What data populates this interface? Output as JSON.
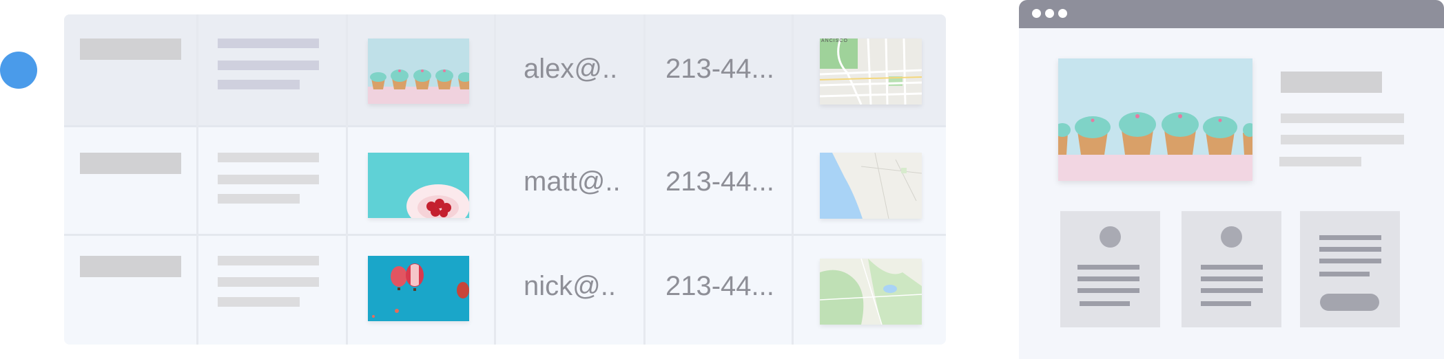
{
  "table": {
    "rows": [
      {
        "email": "alex@..",
        "phone": "213-44...",
        "image": "cupcakes-photo",
        "map": "city-street-map"
      },
      {
        "email": "matt@..",
        "phone": "213-44...",
        "image": "strawberry-bowl-photo",
        "map": "coastline-map"
      },
      {
        "email": "nick@..",
        "phone": "213-44...",
        "image": "hot-air-balloons-photo",
        "map": "terrain-map"
      }
    ],
    "map_label": "ANCISCO"
  },
  "colors": {
    "accent_dot": "#4a9bea",
    "browser_bar": "#8e8f9b",
    "selected_row": "#eaedf3",
    "table_bg": "#f4f7fc"
  },
  "browser": {
    "hero_image": "cupcakes-photo",
    "cards": [
      "profile-card",
      "profile-card",
      "text-card-with-button"
    ]
  }
}
